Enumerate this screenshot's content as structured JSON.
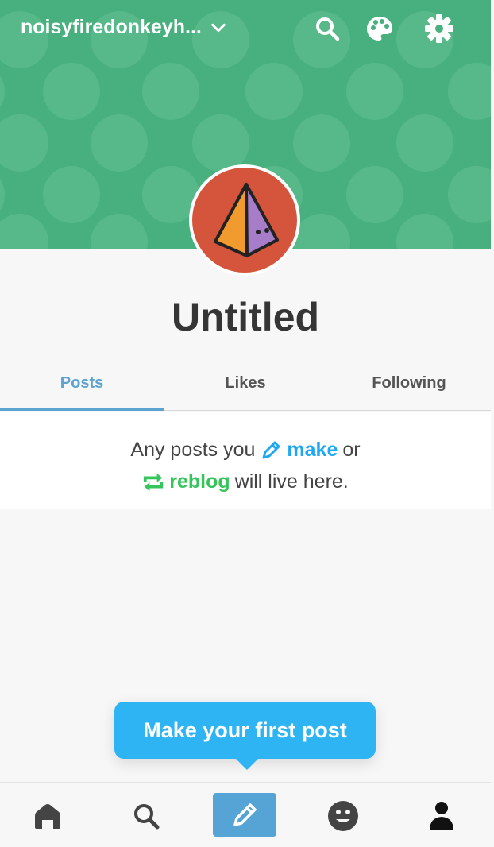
{
  "header": {
    "blog_name": "noisyfiredonkeyh...",
    "blog_dropdown_icon": "chevron-down-icon",
    "search_icon": "search-icon",
    "palette_icon": "palette-icon",
    "settings_icon": "gear-icon",
    "banner_color": "#48b07e"
  },
  "profile": {
    "avatar_icon": "pyramid-avatar",
    "title": "Untitled"
  },
  "tabs": [
    {
      "label": "Posts",
      "active": true
    },
    {
      "label": "Likes",
      "active": false
    },
    {
      "label": "Following",
      "active": false
    }
  ],
  "empty_state": {
    "line1_prefix": "Any posts you",
    "make_label": "make",
    "line1_suffix": "or",
    "reblog_label": "reblog",
    "line2_suffix": "will live here."
  },
  "tooltip": {
    "label": "Make your first post"
  },
  "bottom_nav": {
    "home_icon": "home-icon",
    "search_icon": "search-icon",
    "compose_icon": "pencil-icon",
    "activity_icon": "smiley-icon",
    "account_icon": "person-icon"
  },
  "colors": {
    "accent": "#5ca3d1",
    "make_link": "#1fa8f0",
    "reblog_link": "#36c45c",
    "tooltip_bg": "#2eb4f3",
    "avatar_bg": "#d4553b"
  }
}
